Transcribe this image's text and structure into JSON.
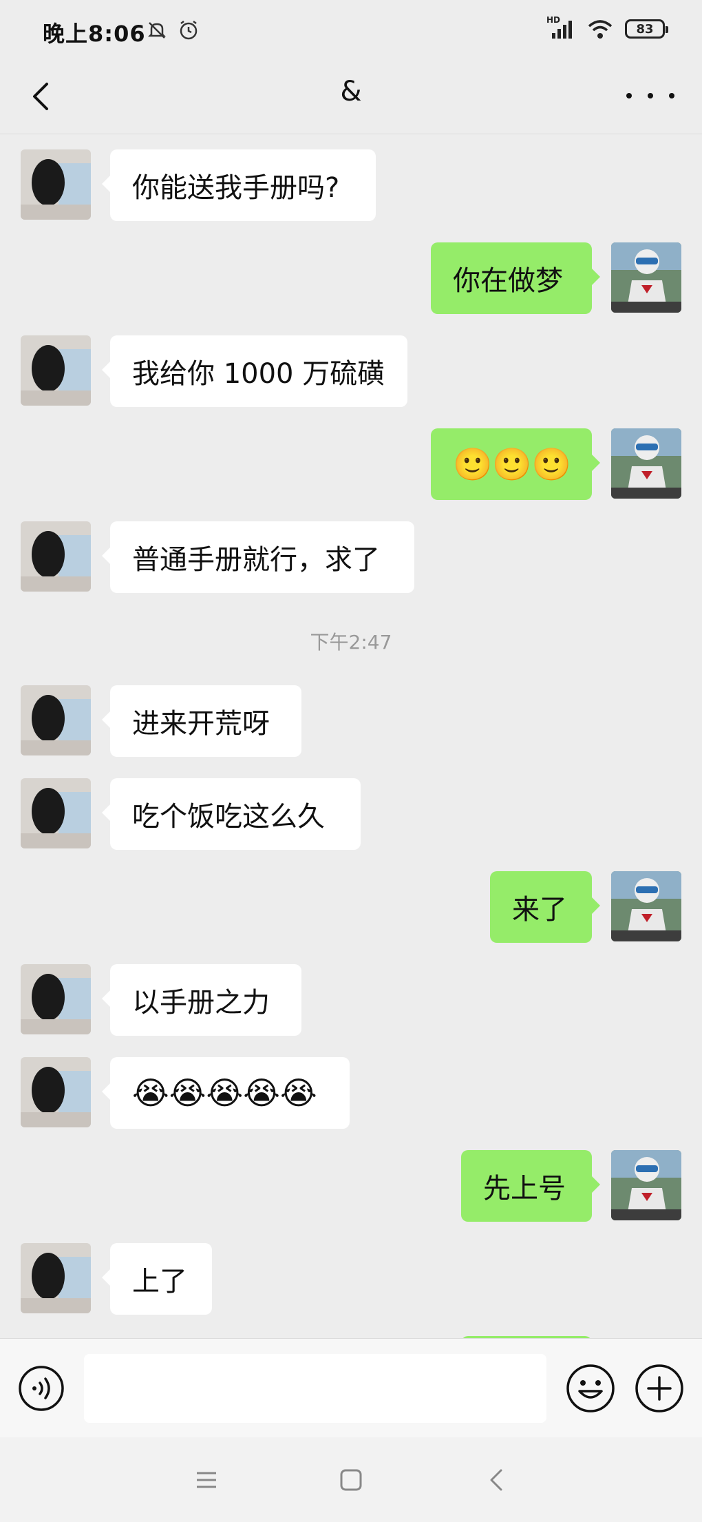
{
  "status_bar": {
    "time": "晚上8:06",
    "battery": "83",
    "network": "HD"
  },
  "header": {
    "title": "&"
  },
  "messages": [
    {
      "side": "in",
      "text": "你能送我手册吗?"
    },
    {
      "side": "out",
      "text": "你在做梦"
    },
    {
      "side": "in",
      "text": "我给你 1000 万硫磺"
    },
    {
      "side": "out",
      "text": "🙂🙂🙂"
    },
    {
      "side": "in",
      "text": "普通手册就行，求了"
    },
    {
      "side": "time",
      "text": "下午2:47"
    },
    {
      "side": "in",
      "text": "进来开荒呀"
    },
    {
      "side": "in",
      "text": "吃个饭吃这么久"
    },
    {
      "side": "out",
      "text": "来了"
    },
    {
      "side": "in",
      "text": "以手册之力"
    },
    {
      "side": "in",
      "text": "😭😭😭😭😭"
    },
    {
      "side": "out",
      "text": "先上号"
    },
    {
      "side": "in",
      "text": "上了"
    }
  ],
  "input": {
    "value": "",
    "placeholder": ""
  },
  "icons": {
    "back": "chevron-left-icon",
    "more": "more-dots-icon",
    "voice": "voice-icon",
    "emoji": "emoji-icon",
    "plus": "plus-icon",
    "nav_menu": "menu-icon",
    "nav_home": "home-icon",
    "nav_back": "back-icon"
  },
  "colors": {
    "background": "#ededed",
    "outgoing_bubble": "#95ec69",
    "incoming_bubble": "#ffffff"
  }
}
